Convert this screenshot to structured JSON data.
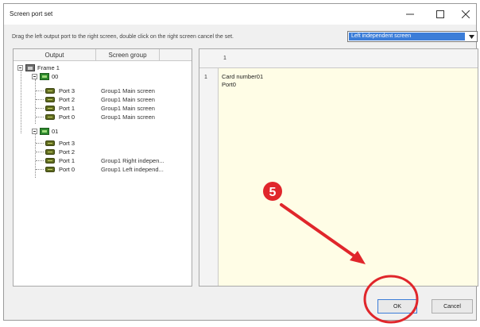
{
  "window": {
    "title": "Screen port set",
    "minimize_glyph": "minimize-icon",
    "maximize_glyph": "maximize-icon",
    "close_glyph": "close-icon"
  },
  "instruction": "Drag the left output port to the right screen, double click on the right screen cancel the set.",
  "screen_select": {
    "value": "Left independent screen"
  },
  "left_table": {
    "headers": [
      "Output",
      "Screen group"
    ],
    "frame_label": "Frame 1",
    "cards": [
      {
        "label": "00",
        "ports": [
          {
            "label": "Port 3",
            "group": "Group1 Main screen"
          },
          {
            "label": "Port 2",
            "group": "Group1 Main screen"
          },
          {
            "label": "Port 1",
            "group": "Group1 Main screen"
          },
          {
            "label": "Port 0",
            "group": "Group1 Main screen"
          }
        ]
      },
      {
        "label": "01",
        "ports": [
          {
            "label": "Port 3",
            "group": ""
          },
          {
            "label": "Port 2",
            "group": ""
          },
          {
            "label": "Port 1",
            "group": "Group1 Right indepen..."
          },
          {
            "label": "Port 0",
            "group": "Group1 Left independ..."
          }
        ]
      }
    ]
  },
  "right_grid": {
    "col_header": "1",
    "row_header": "1",
    "cell_line1": "Card number01",
    "cell_line2": "Port0"
  },
  "annotation": {
    "step_number": "5",
    "accent": "#e0262b"
  },
  "buttons": {
    "ok": "OK",
    "cancel": "Cancel"
  }
}
